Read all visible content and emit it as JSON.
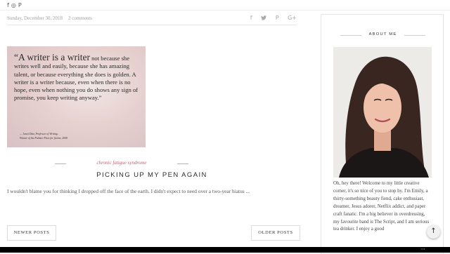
{
  "topbar": {
    "social_icons": [
      {
        "icon": "facebook-icon",
        "glyph": "f"
      },
      {
        "icon": "instagram-icon",
        "glyph": "◎"
      },
      {
        "icon": "pinterest-icon",
        "glyph": "P"
      }
    ]
  },
  "post": {
    "date": "Sunday, December 30, 2018",
    "comments": "2 comments",
    "share_icons": [
      {
        "icon": "facebook-share-icon",
        "glyph": "f"
      },
      {
        "icon": "twitter-share-icon",
        "glyph": "🐦"
      },
      {
        "icon": "pinterest-share-icon",
        "glyph": "P"
      },
      {
        "icon": "google-plus-share-icon",
        "glyph": "G+"
      }
    ],
    "image": {
      "quote_open": "“A writer is a writer",
      "quote_rest": " not because she writes well and easily, because she has amazing talent, or because everything she does is golden. A writer is a writer because, even when there is no hope, even when nothing you do shows any sign of promise, you keep writing anyway.”",
      "attribution_1": "— Junot Díaz, Professor of Writing,",
      "attribution_2": "Winner of the Pulitzer Prize for fiction, 2008"
    },
    "category": "chronic fatigue syndrome",
    "title": "PICKING UP MY PEN AGAIN",
    "excerpt": "I wouldn't blame you for thinking I dropped off the face of the earth. I didn't expect to need over a two-year hiatus ..."
  },
  "pager": {
    "newer": "NEWER POSTS",
    "older": "OLDER POSTS"
  },
  "sidebar": {
    "about_title": "ABOUT ME",
    "about_text": "Oh, hey there! Welcome to my little creative corner, it's so nice of you to stop by. I'm Emily, a thirty-something beauty fiend, cake enthusiast, dreamer, Jesus adorer, Netflix addict, and paper craft fanatic. I'm a big believer in overdressing, my favourite band is The Script, and I am serious tea drinker. I enjoy a good"
  },
  "controls": {
    "scroll_top_glyph": "↑",
    "nav_glyph": "⋯"
  },
  "colors": {
    "accent": "#c65e6d",
    "muted_text": "#a0a0a0"
  }
}
